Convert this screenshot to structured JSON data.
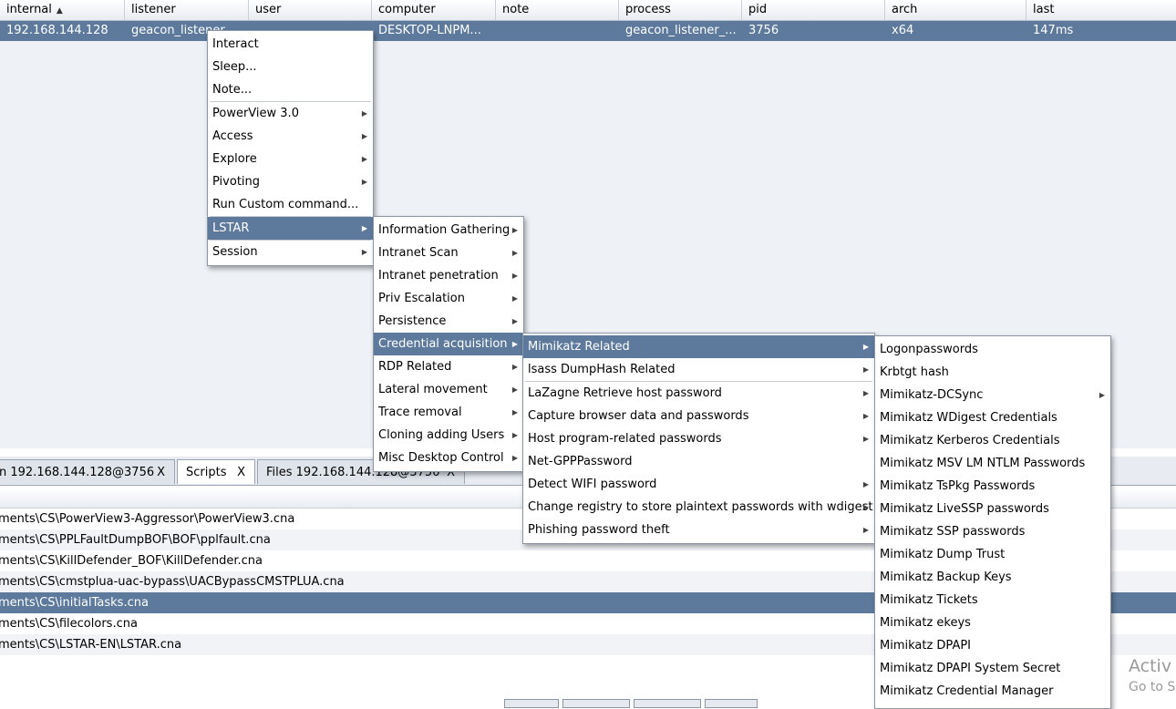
{
  "table": {
    "columns": [
      "internal",
      "listener",
      "user",
      "computer",
      "note",
      "process",
      "pid",
      "arch",
      "last"
    ],
    "row": {
      "internal": "192.168.144.128",
      "listener": "geacon_listener_",
      "user": "",
      "computer": "DESKTOP-LNPM...",
      "note": "",
      "process": "geacon_listener_...",
      "pid": "3756",
      "arch": "x64",
      "last": "147ms"
    }
  },
  "tabs": [
    {
      "label": "n 192.168.144.128@3756",
      "close": "X"
    },
    {
      "label": "Scripts",
      "close": "X"
    },
    {
      "label": "Files 192.168.144.128@3756",
      "close": "X"
    }
  ],
  "scripts": [
    "ments\\CS\\PowerView3-Aggressor\\PowerView3.cna",
    "ments\\CS\\PPLFaultDumpBOF\\BOF\\pplfault.cna",
    "ments\\CS\\KillDefender_BOF\\KillDefender.cna",
    "ments\\CS\\cmstplua-uac-bypass\\UACBypassCMSTPLUA.cna",
    "ments\\CS\\initialTasks.cna",
    "ments\\CS\\filecolors.cna",
    "ments\\CS\\LSTAR-EN\\LSTAR.cna"
  ],
  "menu1": [
    {
      "label": "Interact",
      "sub": false
    },
    {
      "label": "Sleep...",
      "sub": false
    },
    {
      "label": "Note...",
      "sub": false
    },
    {
      "sep": true
    },
    {
      "label": "PowerView 3.0",
      "sub": true
    },
    {
      "label": "Access",
      "sub": true
    },
    {
      "label": "Explore",
      "sub": true
    },
    {
      "label": "Pivoting",
      "sub": true
    },
    {
      "label": "Run Custom command...",
      "sub": false
    },
    {
      "sep": true
    },
    {
      "label": "LSTAR",
      "sub": true,
      "selected": true
    },
    {
      "sep": true
    },
    {
      "label": "Session",
      "sub": true
    }
  ],
  "menu2": [
    {
      "label": "Information Gathering",
      "sub": true
    },
    {
      "label": "Intranet Scan",
      "sub": true
    },
    {
      "label": "Intranet penetration",
      "sub": true
    },
    {
      "label": "Priv Escalation",
      "sub": true
    },
    {
      "label": "Persistence",
      "sub": true
    },
    {
      "label": "Credential acquisition",
      "sub": true,
      "selected": true
    },
    {
      "label": "RDP Related",
      "sub": true
    },
    {
      "label": "Lateral movement",
      "sub": true
    },
    {
      "label": "Trace removal",
      "sub": true
    },
    {
      "label": "Cloning  adding Users",
      "sub": true
    },
    {
      "label": "Misc Desktop Control",
      "sub": true
    }
  ],
  "menu3": [
    {
      "label": "Mimikatz Related",
      "sub": true,
      "selected": true
    },
    {
      "label": "lsass DumpHash Related",
      "sub": true
    },
    {
      "sep": true
    },
    {
      "label": "LaZagne Retrieve host password",
      "sub": true
    },
    {
      "label": "Capture browser data and passwords",
      "sub": true
    },
    {
      "label": "Host program-related passwords",
      "sub": true
    },
    {
      "label": "Net-GPPPassword",
      "sub": false
    },
    {
      "label": "Detect WIFI password",
      "sub": true
    },
    {
      "label": "Change registry to store plaintext passwords with wdigest",
      "sub": true
    },
    {
      "label": "Phishing password theft",
      "sub": true
    }
  ],
  "menu4": [
    {
      "label": "Logonpasswords",
      "sub": false
    },
    {
      "label": "Krbtgt hash",
      "sub": false
    },
    {
      "label": "Mimikatz-DCSync",
      "sub": true
    },
    {
      "label": "Mimikatz WDigest Credentials",
      "sub": false
    },
    {
      "label": "Mimikatz Kerberos Credentials",
      "sub": false
    },
    {
      "label": "Mimikatz MSV LM  NTLM Passwords",
      "sub": false
    },
    {
      "label": "Mimikatz TsPkg Passwords",
      "sub": false
    },
    {
      "label": "Mimikatz LiveSSP passwords",
      "sub": false
    },
    {
      "label": "Mimikatz SSP passwords",
      "sub": false
    },
    {
      "label": "Mimikatz Dump Trust",
      "sub": false
    },
    {
      "label": "Mimikatz Backup Keys",
      "sub": false
    },
    {
      "label": "Mimikatz Tickets",
      "sub": false
    },
    {
      "label": "Mimikatz ekeys",
      "sub": false
    },
    {
      "label": "Mimikatz DPAPI",
      "sub": false
    },
    {
      "label": "Mimikatz DPAPI System Secret",
      "sub": false
    },
    {
      "label": "Mimikatz Credential Manager",
      "sub": false
    }
  ],
  "watermark": {
    "line1": "Activ",
    "line2": "Go to S"
  },
  "colors": {
    "selection": "#5d7a9c",
    "background": "#eef1f6"
  }
}
